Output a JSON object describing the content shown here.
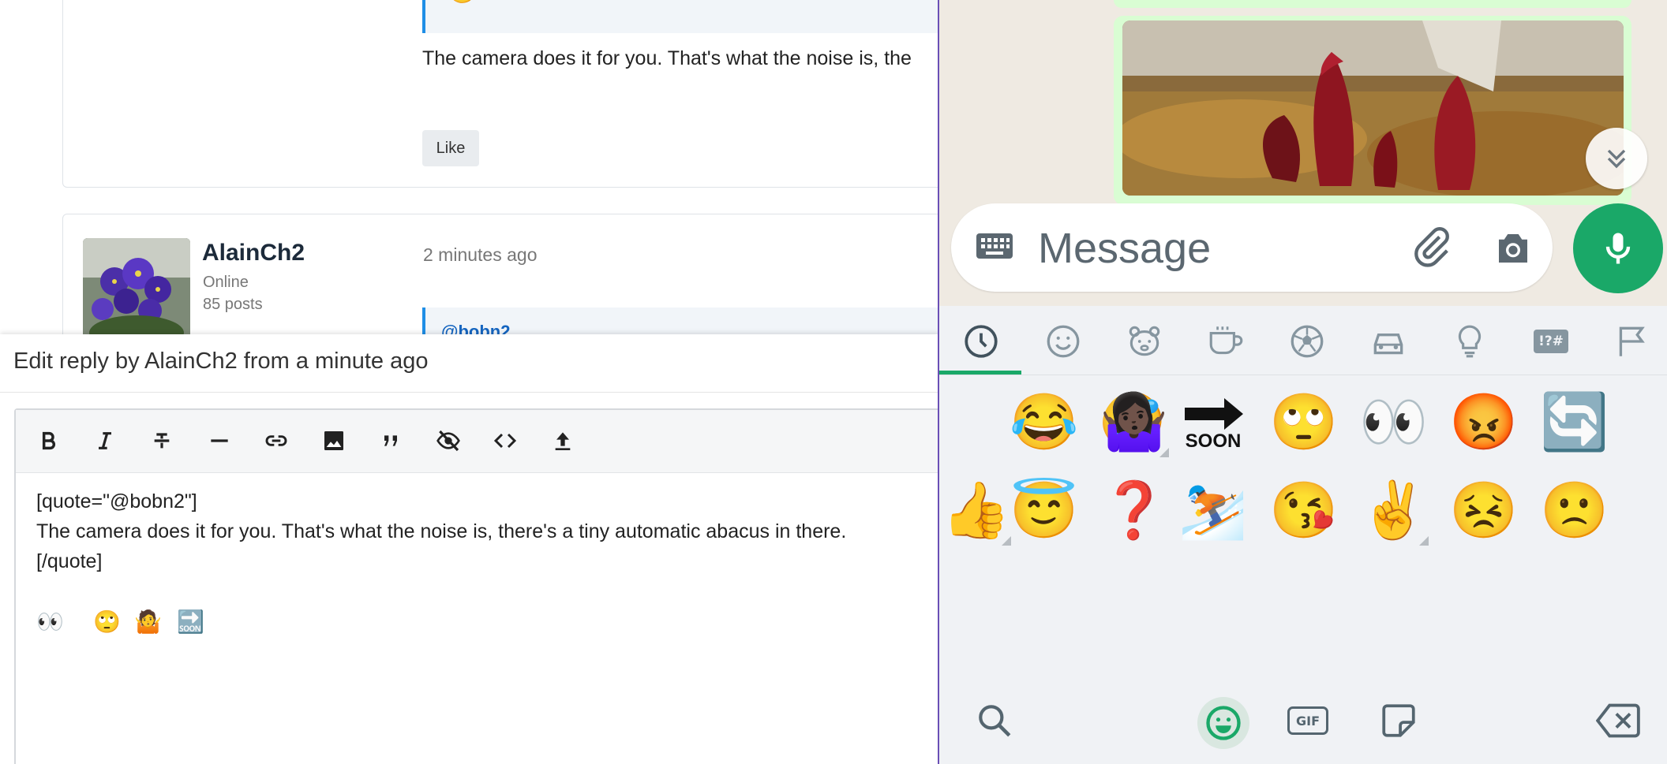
{
  "forum": {
    "post1": {
      "quote_emoji": "😅",
      "body": "The camera does it for you. That's what the noise is, the",
      "like_label": "Like"
    },
    "post2": {
      "username": "AlainCh2",
      "status": "Online",
      "post_count": "85 posts",
      "timestamp": "2 minutes ago",
      "mention": "@bobn2"
    }
  },
  "composer": {
    "title": "Edit reply by AlainCh2 from a minute ago",
    "toolbar": [
      "bold",
      "italic",
      "strikethrough",
      "horizontal-rule",
      "link",
      "image",
      "quote",
      "spoiler",
      "code",
      "upload"
    ],
    "lines": [
      "[quote=\"@bobn2\"]",
      "The camera does it for you. That's what the noise is, there's a tiny automatic abacus in there.",
      "[/quote]"
    ],
    "emojis": [
      "👀",
      "🙄",
      "🤷",
      "🔜"
    ]
  },
  "whatsapp": {
    "message_placeholder": "Message",
    "categories": [
      "recent",
      "smileys",
      "animals",
      "food",
      "activities",
      "travel",
      "objects",
      "symbols",
      "flags"
    ],
    "symbols_label": "!?#",
    "selected_category": "recent",
    "emoji_rows": [
      [
        "🤣",
        "😂",
        "🤷🏿‍♀️",
        "🔜",
        "🙄",
        "👀",
        "😡",
        "🔄"
      ],
      [
        "👍",
        "😇",
        "❓",
        "⛷️",
        "😘",
        "✌️",
        "😣",
        "🙁"
      ]
    ],
    "soon_label": "SOON",
    "gif_label": "GIF",
    "accent_color": "#1aa868",
    "bubble_color": "#d9fdd3"
  }
}
